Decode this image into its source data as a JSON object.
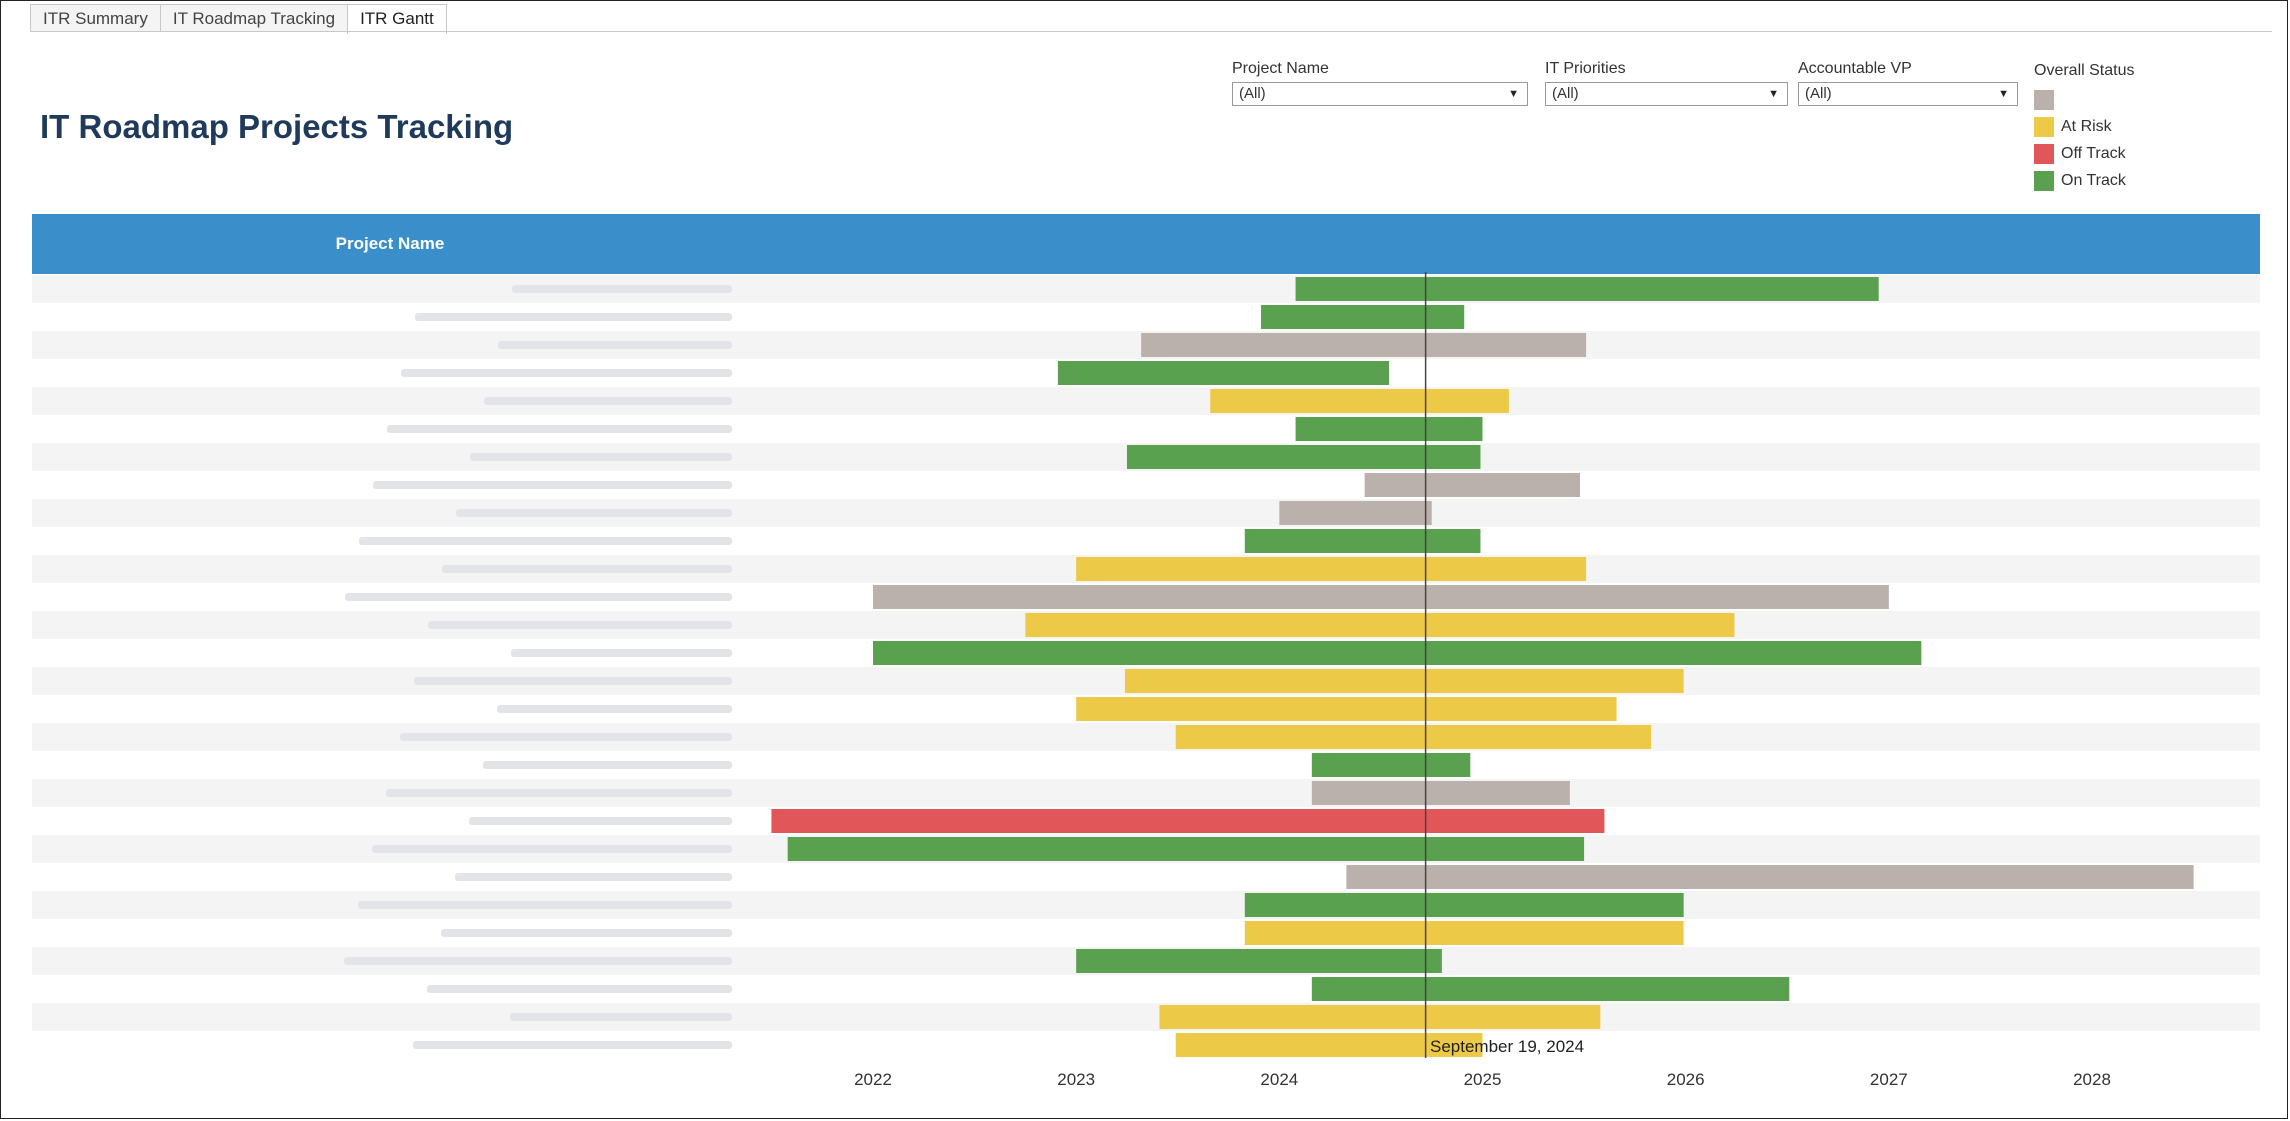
{
  "tabs": [
    {
      "label": "ITR Summary",
      "active": false
    },
    {
      "label": "IT Roadmap Tracking",
      "active": false
    },
    {
      "label": "ITR Gantt",
      "active": true
    }
  ],
  "title": "IT Roadmap Projects Tracking",
  "filters": [
    {
      "label": "Project Name",
      "value": "(All)"
    },
    {
      "label": "IT Priorities",
      "value": "(All)"
    },
    {
      "label": "Accountable VP",
      "value": "(All)"
    }
  ],
  "legend": {
    "title": "Overall Status",
    "items": [
      {
        "label": "",
        "color": "#bab0ac"
      },
      {
        "label": "At Risk",
        "color": "#edc948"
      },
      {
        "label": "Off Track",
        "color": "#e15759"
      },
      {
        "label": "On Track",
        "color": "#59a14f"
      }
    ]
  },
  "header_label": "Project Name",
  "today": {
    "value": 2024.72,
    "label": "September 19, 2024"
  },
  "chart_data": {
    "type": "gantt",
    "x_ticks": [
      "2022",
      "2023",
      "2024",
      "2025",
      "2026",
      "2027",
      "2028"
    ],
    "xlim": [
      2021.45,
      2028.6
    ],
    "colors": {
      "Unknown": "#bab0ac",
      "At Risk": "#edc948",
      "Off Track": "#e15759",
      "On Track": "#59a14f"
    },
    "tasks": [
      {
        "start": 2024.08,
        "end": 2026.95,
        "status": "On Track"
      },
      {
        "start": 2023.91,
        "end": 2024.91,
        "status": "On Track"
      },
      {
        "start": 2023.32,
        "end": 2025.51,
        "status": "Unknown"
      },
      {
        "start": 2022.91,
        "end": 2024.54,
        "status": "On Track"
      },
      {
        "start": 2023.66,
        "end": 2025.13,
        "status": "At Risk"
      },
      {
        "start": 2024.08,
        "end": 2025.0,
        "status": "On Track"
      },
      {
        "start": 2023.25,
        "end": 2024.99,
        "status": "On Track"
      },
      {
        "start": 2024.42,
        "end": 2025.48,
        "status": "Unknown"
      },
      {
        "start": 2024.0,
        "end": 2024.75,
        "status": "Unknown"
      },
      {
        "start": 2023.83,
        "end": 2024.99,
        "status": "On Track"
      },
      {
        "start": 2023.0,
        "end": 2025.51,
        "status": "At Risk"
      },
      {
        "start": 2022.0,
        "end": 2027.0,
        "status": "Unknown"
      },
      {
        "start": 2022.75,
        "end": 2026.24,
        "status": "At Risk"
      },
      {
        "start": 2022.0,
        "end": 2027.16,
        "status": "On Track"
      },
      {
        "start": 2023.24,
        "end": 2025.99,
        "status": "At Risk"
      },
      {
        "start": 2023.0,
        "end": 2025.66,
        "status": "At Risk"
      },
      {
        "start": 2023.49,
        "end": 2025.83,
        "status": "At Risk"
      },
      {
        "start": 2024.16,
        "end": 2024.94,
        "status": "On Track"
      },
      {
        "start": 2024.16,
        "end": 2025.43,
        "status": "Unknown"
      },
      {
        "start": 2021.5,
        "end": 2025.6,
        "status": "Off Track"
      },
      {
        "start": 2021.58,
        "end": 2025.5,
        "status": "On Track"
      },
      {
        "start": 2024.33,
        "end": 2028.5,
        "status": "Unknown"
      },
      {
        "start": 2023.83,
        "end": 2025.99,
        "status": "On Track"
      },
      {
        "start": 2023.83,
        "end": 2025.99,
        "status": "At Risk"
      },
      {
        "start": 2023.0,
        "end": 2024.8,
        "status": "On Track"
      },
      {
        "start": 2024.16,
        "end": 2026.51,
        "status": "On Track"
      },
      {
        "start": 2023.41,
        "end": 2025.58,
        "status": "At Risk"
      },
      {
        "start": 2023.49,
        "end": 2025.0,
        "status": "At Risk"
      }
    ]
  }
}
